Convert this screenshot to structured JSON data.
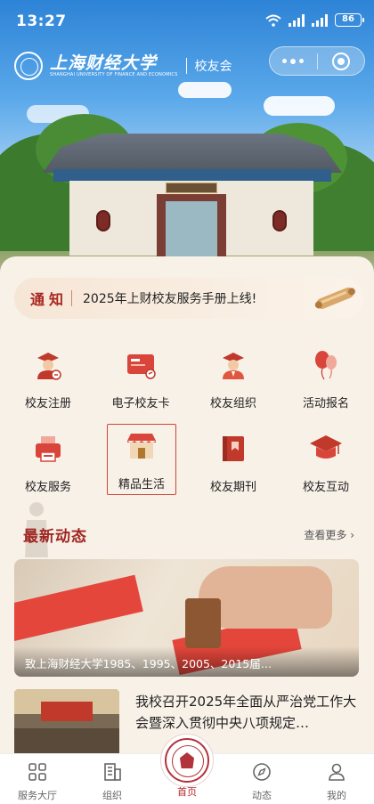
{
  "status_bar": {
    "time": "13:27",
    "battery": "86"
  },
  "header": {
    "logo_cn": "上海财经大学",
    "logo_en": "SHANGHAI UNIVERSITY OF FINANCE AND ECONOMICS",
    "sub_title": "校友会"
  },
  "notice": {
    "tag": "通知",
    "text": "2025年上财校友服务手册上线!"
  },
  "grid": {
    "items": [
      {
        "label": "校友注册"
      },
      {
        "label": "电子校友卡"
      },
      {
        "label": "校友组织"
      },
      {
        "label": "活动报名"
      },
      {
        "label": "校友服务"
      },
      {
        "label": "精品生活"
      },
      {
        "label": "校友期刊"
      },
      {
        "label": "校友互动"
      }
    ]
  },
  "news": {
    "section_title": "最新动态",
    "more_label": "查看更多",
    "featured_caption": "致上海财经大学1985、1995、2005、2015届…",
    "items": [
      {
        "title": "我校召开2025年全面从严治党工作大会暨深入贯彻中央八项规定…"
      }
    ]
  },
  "tabbar": {
    "items": [
      {
        "label": "服务大厅"
      },
      {
        "label": "组织"
      },
      {
        "label": "首页"
      },
      {
        "label": "动态"
      },
      {
        "label": "我的"
      }
    ]
  },
  "colors": {
    "accent": "#a8261f",
    "active_tab": "#b2272b",
    "page_bg": "#f8f1e8"
  }
}
